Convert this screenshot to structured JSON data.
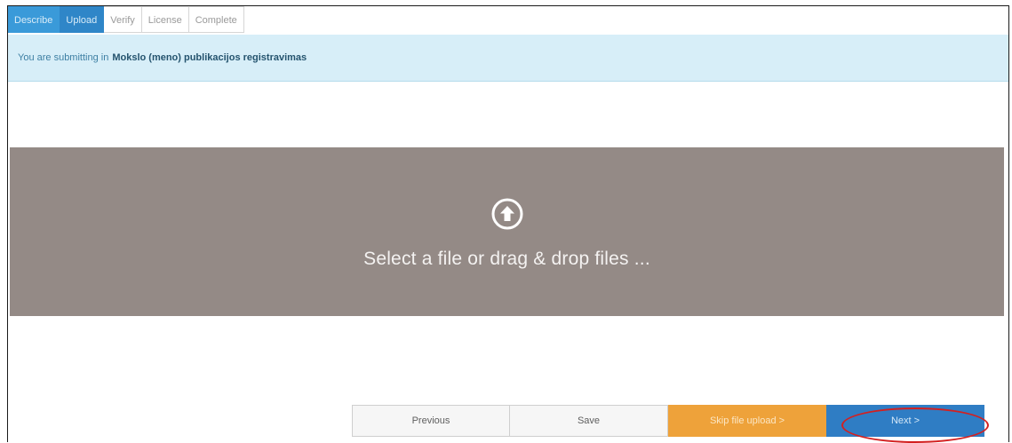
{
  "steps": [
    {
      "label": "Describe",
      "state": "done"
    },
    {
      "label": "Upload",
      "state": "active"
    },
    {
      "label": "Verify",
      "state": "pending"
    },
    {
      "label": "License",
      "state": "pending"
    },
    {
      "label": "Complete",
      "state": "pending"
    }
  ],
  "info": {
    "prefix": "You are submitting in",
    "collection": "Mokslo (meno) publikacijos registravimas"
  },
  "upload": {
    "icon": "upload-arrow-circle-icon",
    "prompt": "Select a file or drag & drop files ..."
  },
  "buttons": {
    "previous": "Previous",
    "save": "Save",
    "skip": "Skip file upload >",
    "next": "Next >"
  },
  "colors": {
    "step_done": "#3a9ad9",
    "step_active": "#2f86c8",
    "info_bg": "#d7eef8",
    "dropzone_bg": "#948a86",
    "skip_btn": "#eea23a",
    "next_btn": "#2f7dc4",
    "annotation_ring": "#d32020"
  }
}
